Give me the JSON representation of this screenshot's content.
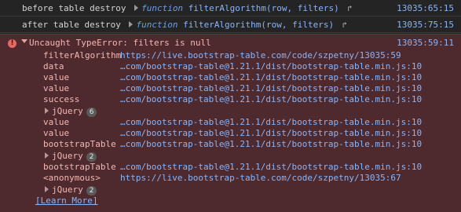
{
  "logs": [
    {
      "text": "before table destroy",
      "fn_keyword": "function",
      "fn_name": "filterAlgorithm",
      "args": "(row, filters)",
      "source": "13035:65:15"
    },
    {
      "text": "after table destroy",
      "fn_keyword": "function",
      "fn_name": "filterAlgorithm",
      "args": "(row, filters)",
      "source": "13035:75:15"
    }
  ],
  "error": {
    "message": "Uncaught TypeError: filters is null",
    "source": "13035:59:11",
    "frames": [
      {
        "name": "filterAlgorithm",
        "location": "https://live.bootstrap-table.com/code/szpetny/13035:59"
      },
      {
        "name": "data",
        "location": "…com/bootstrap-table@1.21.1/dist/bootstrap-table.min.js:10"
      },
      {
        "name": "value",
        "location": "…com/bootstrap-table@1.21.1/dist/bootstrap-table.min.js:10"
      },
      {
        "name": "value",
        "location": "…com/bootstrap-table@1.21.1/dist/bootstrap-table.min.js:10"
      },
      {
        "name": "success",
        "location": "…com/bootstrap-table@1.21.1/dist/bootstrap-table.min.js:10"
      },
      {
        "name": "value",
        "location": "…com/bootstrap-table@1.21.1/dist/bootstrap-table.min.js:10"
      },
      {
        "name": "value",
        "location": "…com/bootstrap-table@1.21.1/dist/bootstrap-table.min.js:10"
      },
      {
        "name": "bootstrapTable",
        "location": "…com/bootstrap-table@1.21.1/dist/bootstrap-table.min.js:10"
      },
      {
        "name": "bootstrapTable",
        "location": "…com/bootstrap-table@1.21.1/dist/bootstrap-table.min.js:10"
      },
      {
        "name": "<anonymous>",
        "location": "https://live.bootstrap-table.com/code/szpetny/13035:67"
      }
    ],
    "jquery_groups": [
      {
        "label": "jQuery",
        "count": "6"
      },
      {
        "label": "jQuery",
        "count": "2"
      },
      {
        "label": "jQuery",
        "count": "2"
      }
    ],
    "learn_more": "[Learn More]"
  }
}
